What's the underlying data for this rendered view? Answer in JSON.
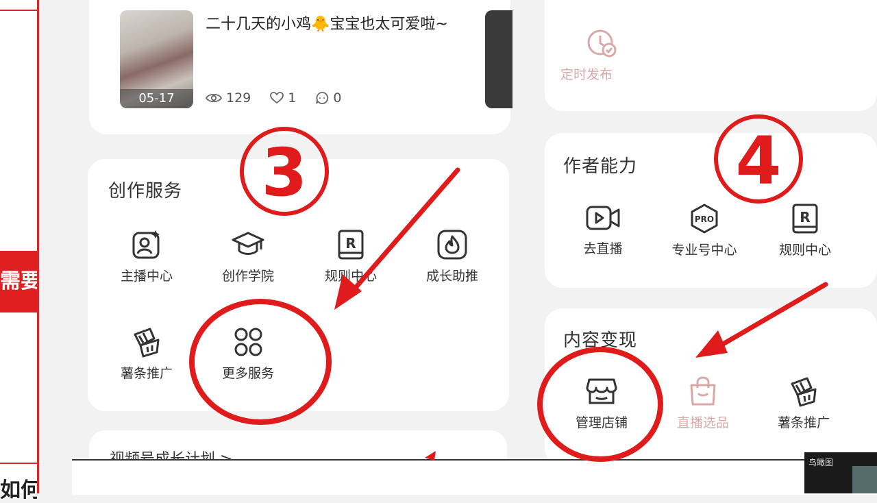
{
  "video": {
    "title": "二十几天的小鸡🐥宝宝也太可爱啦~",
    "date": "05-17",
    "views": "129",
    "likes": "1",
    "comments": "0"
  },
  "creation_services": {
    "title": "创作服务",
    "items": [
      {
        "label": "主播中心",
        "icon": "anchor-center-icon"
      },
      {
        "label": "创作学院",
        "icon": "graduation-cap-icon"
      },
      {
        "label": "规则中心",
        "icon": "rulebook-icon"
      },
      {
        "label": "成长助推",
        "icon": "flame-icon"
      },
      {
        "label": "薯条推广",
        "icon": "fries-icon"
      },
      {
        "label": "更多服务",
        "icon": "grid-dots-icon"
      }
    ]
  },
  "growth_plan": {
    "label": "视频号成长计划 >"
  },
  "scheduled": {
    "label": "定时发布"
  },
  "author_ability": {
    "title": "作者能力",
    "items": [
      {
        "label": "去直播",
        "icon": "live-camera-icon"
      },
      {
        "label": "专业号中心",
        "icon": "pro-badge-icon"
      },
      {
        "label": "规则中心",
        "icon": "rulebook-icon"
      }
    ]
  },
  "content_monetization": {
    "title": "内容变现",
    "items": [
      {
        "label": "管理店铺",
        "icon": "shop-icon"
      },
      {
        "label": "直播选品",
        "icon": "shopping-bag-icon"
      },
      {
        "label": "薯条推广",
        "icon": "fries-icon"
      }
    ]
  },
  "annotations": {
    "step3": "③",
    "step4": "④"
  },
  "left_strip": {
    "banner": "需要",
    "bottom": "如何"
  },
  "corner": {
    "label": "鸟瞰图"
  },
  "colors": {
    "accent": "#d62828",
    "annotation": "#e01b1b"
  }
}
